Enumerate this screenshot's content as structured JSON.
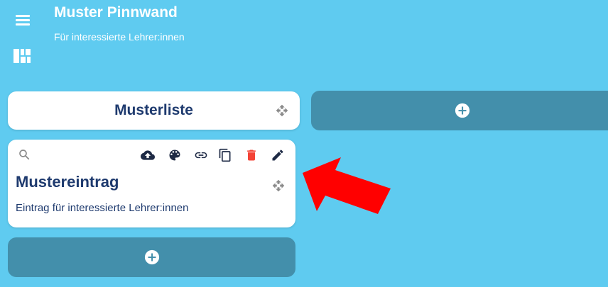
{
  "header": {
    "title": "Muster Pinnwand",
    "subtitle": "Für interessierte Lehrer:innen",
    "menu_icon": "menu-icon",
    "board_icon": "dashboard-icon"
  },
  "column": {
    "title": "Musterliste",
    "move_icon": "move-icon"
  },
  "entry": {
    "title": "Mustereintrag",
    "text": "Eintrag für interessierte Lehrer:innen",
    "toolbar": [
      "search-icon",
      "upload-icon",
      "palette-icon",
      "link-icon",
      "copy-icon",
      "delete-icon",
      "edit-icon"
    ]
  },
  "colors": {
    "background": "#5fcbf0",
    "card": "#ffffff",
    "add_button": "#438fab",
    "text": "#1e3a6e",
    "delete": "#f44336",
    "arrow": "#ff0000"
  }
}
